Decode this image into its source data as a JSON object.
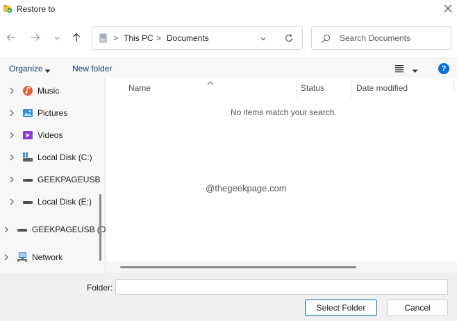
{
  "window": {
    "title": "Restore to",
    "close_icon": "close-icon"
  },
  "navigation": {
    "back_icon": "arrow-left-icon",
    "forward_icon": "arrow-right-icon",
    "recent_icon": "chevron-down-icon",
    "up_icon": "arrow-up-icon"
  },
  "address": {
    "breadcrumbs": [
      "This PC",
      "Documents"
    ],
    "separator": ">"
  },
  "search": {
    "placeholder": "Search Documents"
  },
  "toolbar": {
    "organize_label": "Organize",
    "new_folder_label": "New folder",
    "help_label": "?"
  },
  "sidebar": {
    "items": [
      {
        "label": "Music",
        "icon": "music-icon"
      },
      {
        "label": "Pictures",
        "icon": "pictures-icon"
      },
      {
        "label": "Videos",
        "icon": "videos-icon"
      },
      {
        "label": "Local Disk (C:)",
        "icon": "windows-drive-icon"
      },
      {
        "label": "GEEKPAGEUSB",
        "icon": "usb-drive-icon"
      },
      {
        "label": "Local Disk (E:)",
        "icon": "drive-icon"
      },
      {
        "label": "GEEKPAGEUSB (D",
        "icon": "usb-drive-icon"
      },
      {
        "label": "Network",
        "icon": "network-icon"
      }
    ]
  },
  "content": {
    "columns": [
      "Name",
      "Status",
      "Date modified"
    ],
    "empty_message": "No items match your search.",
    "watermark": "@thegeekpage.com"
  },
  "footer": {
    "folder_label": "Folder:",
    "folder_value": "",
    "select_button": "Select Folder",
    "cancel_button": "Cancel"
  },
  "colors": {
    "accent": "#0067c0",
    "help": "#0a6fd4",
    "link": "#1a3d6e"
  }
}
